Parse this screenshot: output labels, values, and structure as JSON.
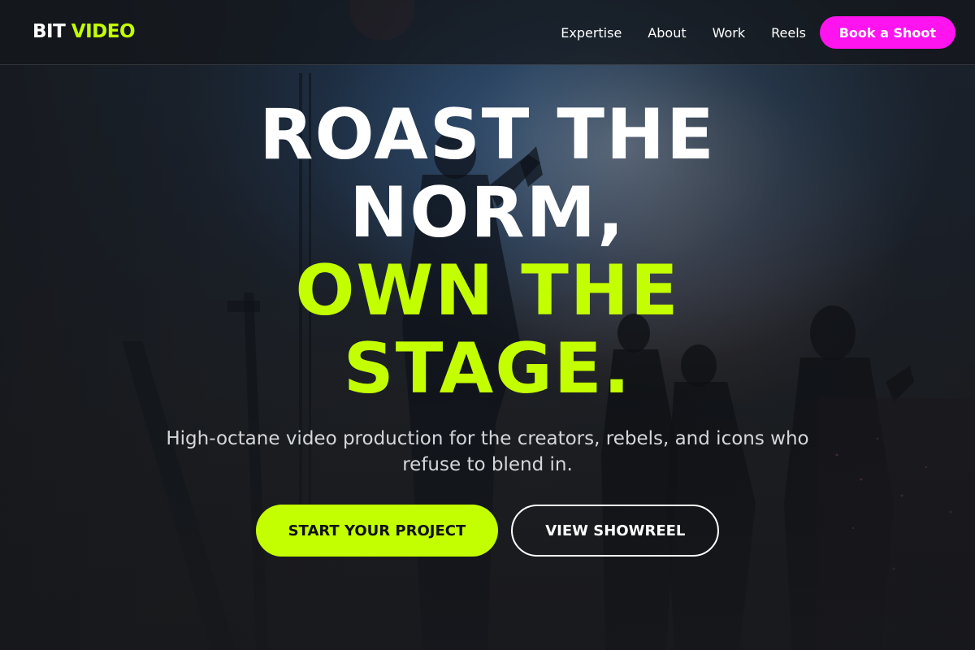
{
  "brand": {
    "logo_part1": "BIT",
    "logo_part2": "VIDEO"
  },
  "nav": {
    "items": [
      {
        "label": "Expertise"
      },
      {
        "label": "About"
      },
      {
        "label": "Work"
      },
      {
        "label": "Reels"
      }
    ],
    "cta_label": "Book a Shoot"
  },
  "hero": {
    "headline_line1": "ROAST THE",
    "headline_line2": "NORM,",
    "headline_line3": "OWN THE",
    "headline_line4": "STAGE.",
    "subtitle": "High-octane video production for the creators, rebels, and icons who refuse to blend in.",
    "primary_cta": "START YOUR PROJECT",
    "secondary_cta": "VIEW SHOWREEL",
    "background_image": "concert-stage-silhouettes"
  },
  "colors": {
    "accent_lime": "#c4ff00",
    "accent_magenta": "#ff14f0",
    "header_bg": "#16181c",
    "text_white": "#ffffff"
  }
}
